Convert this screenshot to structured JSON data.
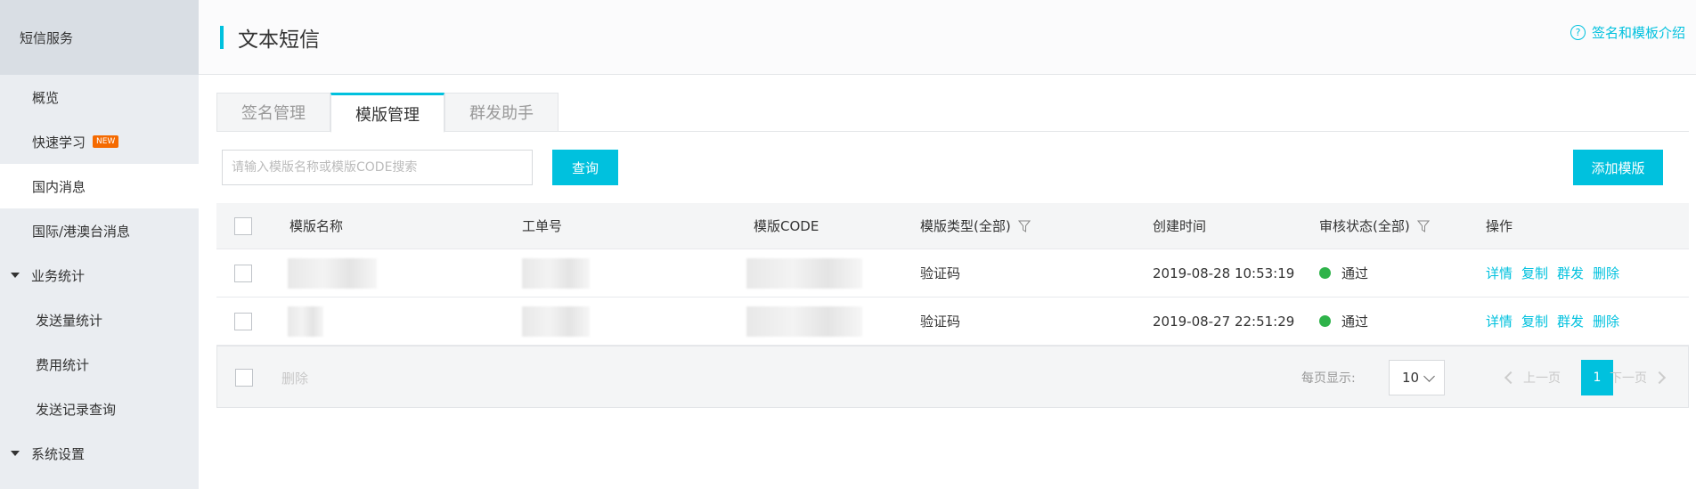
{
  "sidebar": {
    "title": "短信服务",
    "items": [
      {
        "label": "概览"
      },
      {
        "label": "快速学习",
        "badge": "NEW"
      },
      {
        "label": "国内消息"
      },
      {
        "label": "国际/港澳台消息"
      }
    ],
    "group_stats": "业务统计",
    "stats_items": [
      {
        "label": "发送量统计"
      },
      {
        "label": "费用统计"
      },
      {
        "label": "发送记录查询"
      }
    ],
    "group_settings": "系统设置"
  },
  "header": {
    "title": "文本短信",
    "help_icon": "?",
    "help_link": "签名和模板介绍"
  },
  "tabs": [
    {
      "label": "签名管理"
    },
    {
      "label": "模版管理"
    },
    {
      "label": "群发助手"
    }
  ],
  "search": {
    "placeholder": "请输入模版名称或模版CODE搜索",
    "button": "查询"
  },
  "add_button": "添加模版",
  "table": {
    "columns": {
      "name": "模版名称",
      "ticket": "工单号",
      "code": "模版CODE",
      "type": "模版类型(全部)",
      "created": "创建时间",
      "status": "审核状态(全部)",
      "actions": "操作"
    },
    "rows": [
      {
        "type": "验证码",
        "created": "2019-08-28 10:53:19",
        "status": "通过"
      },
      {
        "type": "验证码",
        "created": "2019-08-27 22:51:29",
        "status": "通过"
      }
    ],
    "actions": {
      "detail": "详情",
      "copy": "复制",
      "bulk": "群发",
      "delete": "删除"
    }
  },
  "footer": {
    "delete": "删除",
    "per_page_label": "每页显示:",
    "per_page_value": "10",
    "prev": "上一页",
    "page": "1",
    "next": "下一页"
  },
  "colors": {
    "accent": "#00c1de",
    "success": "#2fb34a",
    "badge": "#f56a00"
  }
}
